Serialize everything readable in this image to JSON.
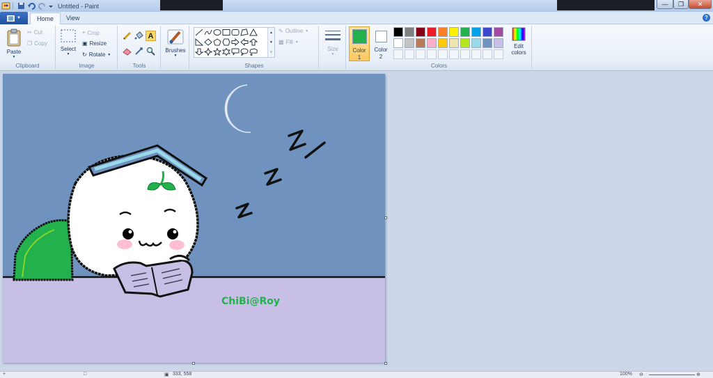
{
  "window": {
    "title": "Untitled - Paint",
    "controls": [
      "minimize",
      "maximize",
      "close"
    ]
  },
  "tabs": [
    {
      "label": "Home",
      "active": true
    },
    {
      "label": "View",
      "active": false
    }
  ],
  "ribbon": {
    "clipboard": {
      "label": "Clipboard",
      "paste": "Paste",
      "cut": "Cut",
      "copy": "Copy"
    },
    "image": {
      "label": "Image",
      "select": "Select",
      "crop": "Crop",
      "resize": "Resize",
      "rotate": "Rotate"
    },
    "tools": {
      "label": "Tools",
      "icons": [
        "pencil-icon",
        "fill-bucket-icon",
        "text-icon",
        "eraser-icon",
        "color-picker-icon",
        "magnifier-icon"
      ]
    },
    "brushes": {
      "label": "Brushes"
    },
    "shapes": {
      "label": "Shapes",
      "outline": "Outline",
      "fill": "Fill"
    },
    "size": {
      "label": "Size"
    },
    "colors": {
      "label": "Colors",
      "color1_label": "Color",
      "color1_num": "1",
      "color2_label": "Color",
      "color2_num": "2",
      "edit_label": "Edit",
      "edit_label2": "colors",
      "color1": "#22b14c",
      "color2": "#ffffff",
      "palette_row1": [
        "#000000",
        "#7f7f7f",
        "#880015",
        "#ed1c24",
        "#ff7f27",
        "#fff200",
        "#22b14c",
        "#00a2e8",
        "#3f48cc",
        "#a349a4"
      ],
      "palette_row2": [
        "#ffffff",
        "#c3c3c3",
        "#b97a57",
        "#ffaec9",
        "#ffc90e",
        "#efe4b0",
        "#b5e61d",
        "#99d9ea",
        "#7092be",
        "#c8bfe7"
      ]
    }
  },
  "canvas": {
    "signature": "ChiBi@Roy",
    "sky_color": "#7092be",
    "floor_color": "#c8bfe7",
    "zzz": [
      "Z",
      "Z",
      "Z"
    ]
  },
  "statusbar": {
    "position": "333, 558",
    "zoom": "100%"
  }
}
